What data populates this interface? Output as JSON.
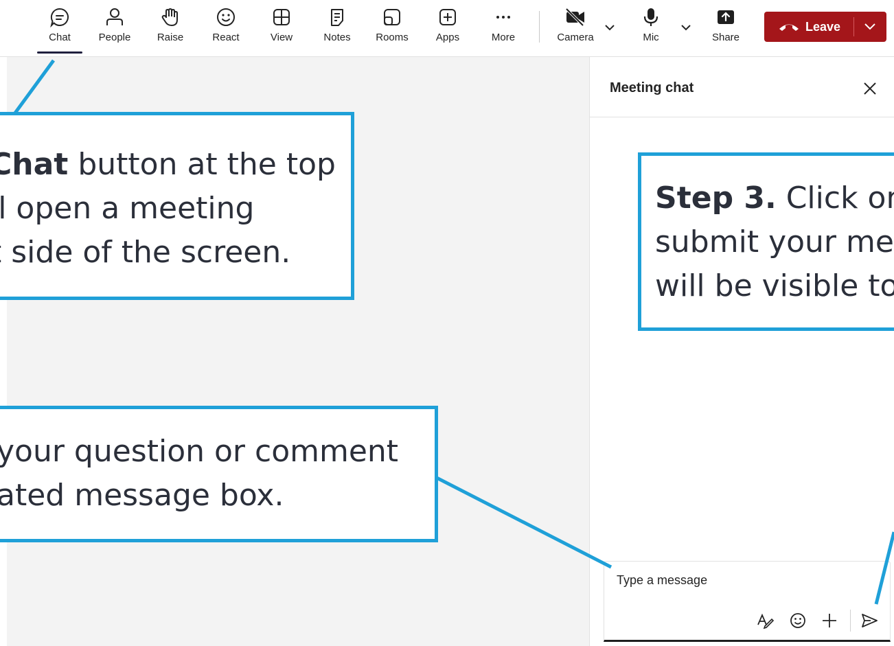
{
  "toolbar": {
    "items": [
      {
        "label": "Chat",
        "icon": "chat-icon"
      },
      {
        "label": "People",
        "icon": "people-icon"
      },
      {
        "label": "Raise",
        "icon": "raise-hand-icon"
      },
      {
        "label": "React",
        "icon": "smiley-icon"
      },
      {
        "label": "View",
        "icon": "grid-view-icon"
      },
      {
        "label": "Notes",
        "icon": "notes-icon"
      },
      {
        "label": "Rooms",
        "icon": "rooms-icon"
      },
      {
        "label": "Apps",
        "icon": "add-app-icon"
      },
      {
        "label": "More",
        "icon": "more-icon"
      }
    ],
    "camera_label": "Camera",
    "mic_label": "Mic",
    "share_label": "Share",
    "leave_label": "Leave",
    "leave_color": "#a4161a"
  },
  "chat_panel": {
    "title": "Meeting chat",
    "input_placeholder": "Type a message"
  },
  "callouts": {
    "step1": {
      "bold": "Chat",
      "line1_rest": " button at the top",
      "line2": "ll open a meeting",
      "line3": "t side of the screen."
    },
    "step2": {
      "line1": " your question or comment",
      "line2": "ated message box."
    },
    "step3": {
      "bold": "Step 3.",
      "line1_rest": " Click on",
      "line2": "submit your me",
      "line3": "will be visible to"
    },
    "accent_color": "#1fa0d8"
  }
}
